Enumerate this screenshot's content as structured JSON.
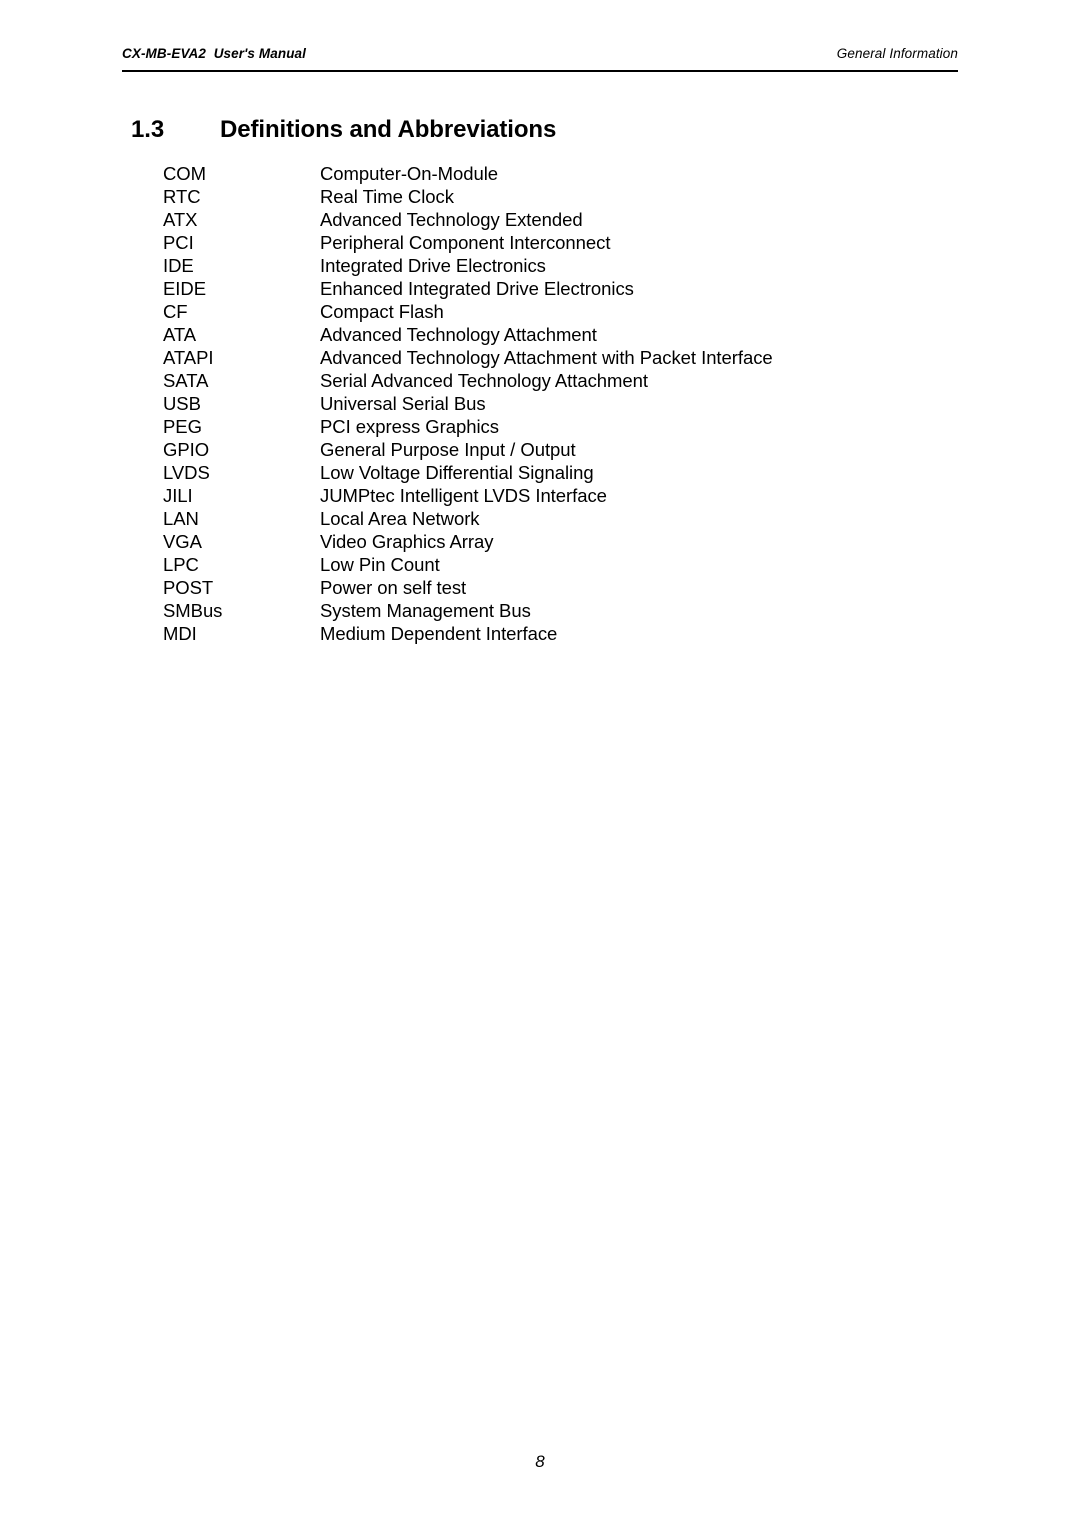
{
  "header": {
    "left": "CX-MB-EVA2  User's Manual",
    "right": "General Information"
  },
  "heading": {
    "number": "1.3",
    "title": "Definitions and Abbreviations"
  },
  "abbreviations": [
    {
      "term": "COM",
      "definition": "Computer-On-Module"
    },
    {
      "term": "RTC",
      "definition": "Real Time Clock"
    },
    {
      "term": "ATX",
      "definition": "Advanced Technology Extended"
    },
    {
      "term": "PCI",
      "definition": "Peripheral Component Interconnect"
    },
    {
      "term": "IDE",
      "definition": "Integrated Drive Electronics"
    },
    {
      "term": "EIDE",
      "definition": "Enhanced Integrated Drive Electronics"
    },
    {
      "term": "CF",
      "definition": "Compact Flash"
    },
    {
      "term": "ATA",
      "definition": "Advanced Technology Attachment"
    },
    {
      "term": "ATAPI",
      "definition": "Advanced Technology Attachment with Packet Interface"
    },
    {
      "term": "SATA",
      "definition": "Serial Advanced Technology Attachment"
    },
    {
      "term": "USB",
      "definition": "Universal Serial Bus"
    },
    {
      "term": "PEG",
      "definition": "PCI express Graphics"
    },
    {
      "term": "GPIO",
      "definition": "General Purpose Input / Output"
    },
    {
      "term": "LVDS",
      "definition": "Low Voltage Differential Signaling"
    },
    {
      "term": "JILI",
      "definition": "JUMPtec Intelligent LVDS Interface"
    },
    {
      "term": "LAN",
      "definition": "Local Area Network"
    },
    {
      "term": "VGA",
      "definition": "Video Graphics Array"
    },
    {
      "term": "LPC",
      "definition": "Low Pin Count"
    },
    {
      "term": "POST",
      "definition": "Power on self test"
    },
    {
      "term": "SMBus",
      "definition": "System Management Bus"
    },
    {
      "term": "MDI",
      "definition": "Medium Dependent Interface"
    }
  ],
  "footer": {
    "page_number": "8"
  },
  "colors": {
    "text": "#000000",
    "background": "#ffffff",
    "rule": "#000000"
  }
}
